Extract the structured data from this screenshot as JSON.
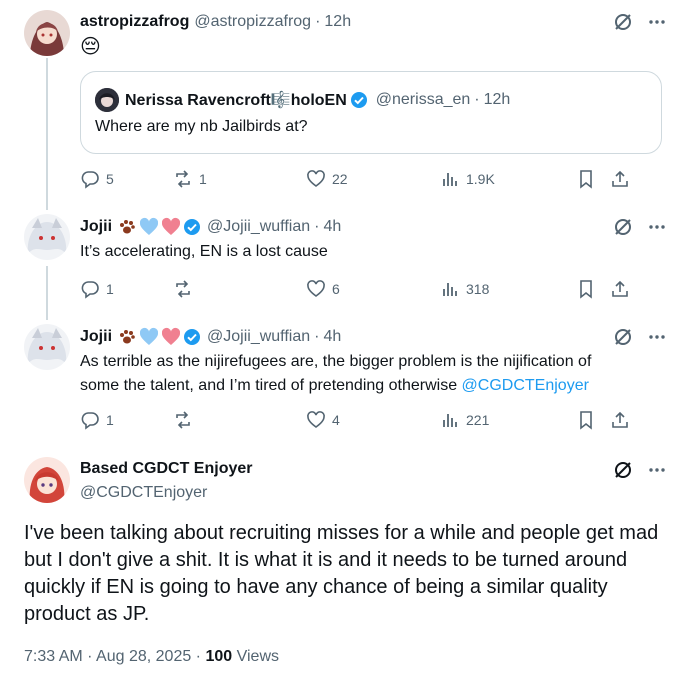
{
  "tweets": [
    {
      "name": "astropizzafrog",
      "handle": "@astropizzafrog",
      "time": "12h",
      "text": "😔",
      "quote": {
        "name": "Nerissa Ravencroft🎼holoEN",
        "handle": "@nerissa_en",
        "time": "12h",
        "text": "Where are my nb Jailbirds at?"
      },
      "stats": {
        "replies": "5",
        "reposts": "1",
        "likes": "22",
        "views": "1.9K"
      }
    },
    {
      "name": "Jojii",
      "handle": "@Jojii_wuffian",
      "time": "4h",
      "text": "It’s accelerating, EN is a lost cause",
      "stats": {
        "replies": "1",
        "reposts": "",
        "likes": "6",
        "views": "318"
      }
    },
    {
      "name": "Jojii",
      "handle": "@Jojii_wuffian",
      "time": "4h",
      "text_line1": "As terrible as the nijirefugees are, the bigger problem is the nijification of",
      "text_line2": "some the talent, and I’m tired of pretending otherwise ",
      "mention": "@CGDCTEnjoyer",
      "stats": {
        "replies": "1",
        "reposts": "",
        "likes": "4",
        "views": "221"
      }
    }
  ],
  "main": {
    "name": "Based CGDCT Enjoyer",
    "handle": "@CGDCTEnjoyer",
    "text": "I've been talking about recruiting misses for a while and people get mad but I don't give a shit. It is what it is and it needs to be turned around quickly if EN is going to have any chance of being a similar quality product as JP.",
    "timestamp": "7:33 AM · Aug 28, 2025 · ",
    "views_count": "100",
    "views_label": " Views"
  },
  "colors": {
    "accent": "#1d9bf0",
    "muted": "#536471",
    "border": "#cfd9de",
    "like": "#f91880"
  },
  "icons": [
    "grok-icon",
    "more-icon",
    "reply-icon",
    "repost-icon",
    "like-icon",
    "views-icon",
    "bookmark-icon",
    "share-icon",
    "verified-badge-icon",
    "paw-icon",
    "blue-heart-icon",
    "pink-heart-icon"
  ]
}
